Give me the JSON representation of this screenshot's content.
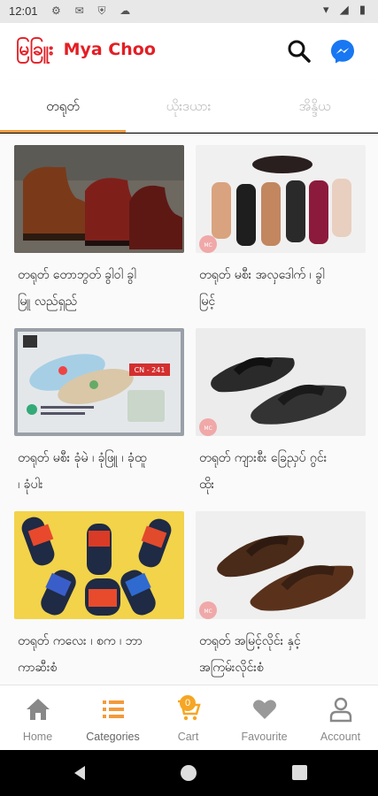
{
  "status": {
    "time": "12:01"
  },
  "app": {
    "logo_my": "မြခြူး",
    "logo_en": "Mya Choo"
  },
  "tabs": [
    {
      "label": "တရုတ်",
      "active": true
    },
    {
      "label": "ယိုးဒယား",
      "active": false
    },
    {
      "label": "အိန္ဒိယ",
      "active": false
    }
  ],
  "products": [
    {
      "title_l1": "တရုတ် တောဘွတ် ခွါဝါ ခွါ",
      "title_l2": "မြူ လည်ရှည်",
      "image": "leather-boots"
    },
    {
      "title_l1": "တရုတ် မစီး အလှဒေါက် ၊ ခွါ",
      "title_l2": "မြင့်",
      "image": "womens-heeled-sandals"
    },
    {
      "title_l1": "တရုတ် မစီး ခုံမဲ ၊ ခုံဖြူ ၊ ခုံထူ",
      "title_l2": "၊ ခုံပါး",
      "image": "flip-flops",
      "image_tag": "CN - 241"
    },
    {
      "title_l1": "တရုတ် ကျားစီး ခြေညှပ် ဂွင်း",
      "title_l2": "ထိုး",
      "image": "black-flip-flops"
    },
    {
      "title_l1": "တရုတ် ကလေး ၊ စက ၊ ဘာ",
      "title_l2": "ကာဆီးစံ",
      "image": "slide-sandals"
    },
    {
      "title_l1": "တရုတ် အမြင့်လိုင်း နှင့်",
      "title_l2": "အကြမ်းလိုင်းစံ",
      "image": "brown-flip-flops"
    }
  ],
  "nav": [
    {
      "label": "Home",
      "icon": "home-icon"
    },
    {
      "label": "Categories",
      "icon": "list-icon",
      "active": true
    },
    {
      "label": "Cart",
      "icon": "cart-icon",
      "badge": "0"
    },
    {
      "label": "Favourite",
      "icon": "heart-icon"
    },
    {
      "label": "Account",
      "icon": "person-icon"
    }
  ],
  "colors": {
    "brand": "#e31e24",
    "accent": "#f39a3a",
    "messenger": "#1877f2"
  }
}
